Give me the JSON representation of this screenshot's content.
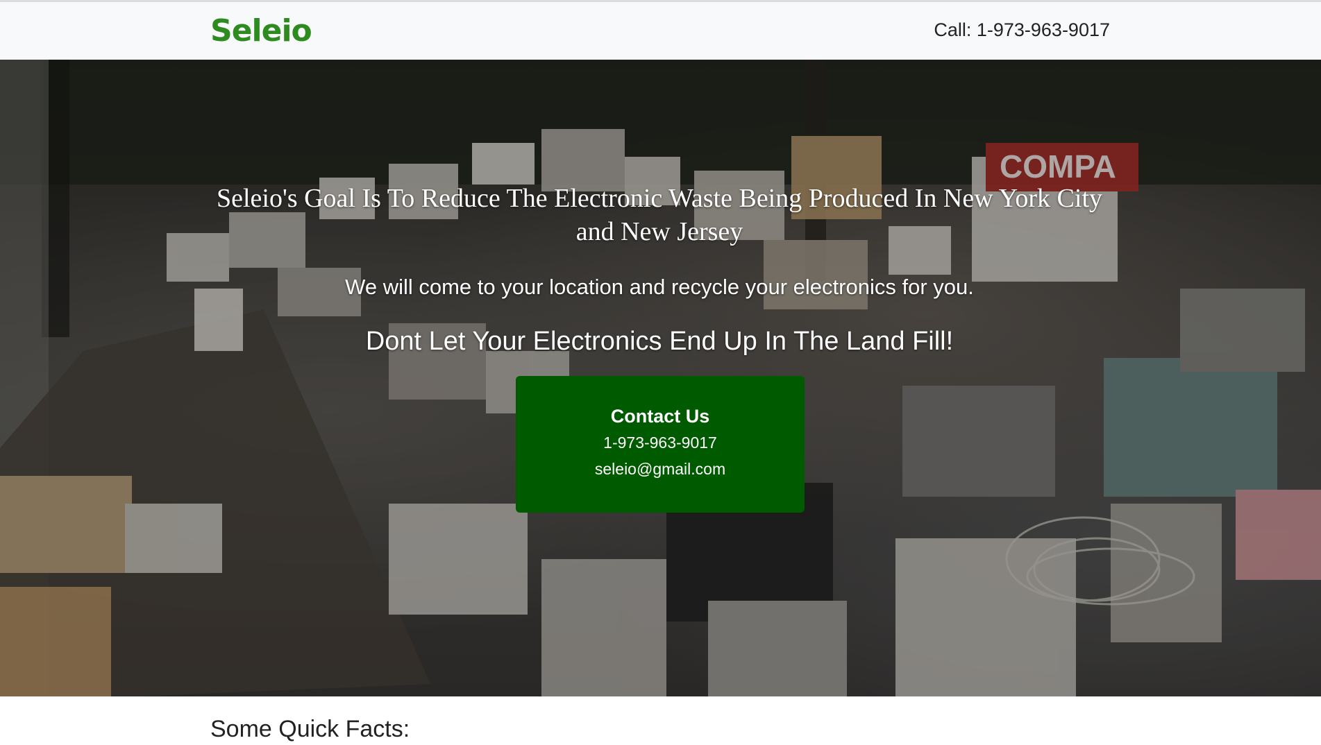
{
  "navbar": {
    "brand": "Seleio",
    "call_text": "Call: 1-973-963-9017"
  },
  "hero": {
    "title": "Seleio's Goal Is To Reduce The Electronic Waste Being Produced In New York City and New Jersey",
    "subtitle": "We will come to your location and recycle your electronics for you.",
    "tagline": "Dont Let Your Electronics End Up In The Land Fill!",
    "background_image_text": "COMPA",
    "contact": {
      "title": "Contact Us",
      "phone": "1-973-963-9017",
      "email": "seleio@gmail.com"
    }
  },
  "facts": {
    "heading": "Some Quick Facts:"
  },
  "colors": {
    "brand": "#2e8b1f",
    "contact_box": "#005a00",
    "navbar_bg": "#f8f9fa"
  }
}
